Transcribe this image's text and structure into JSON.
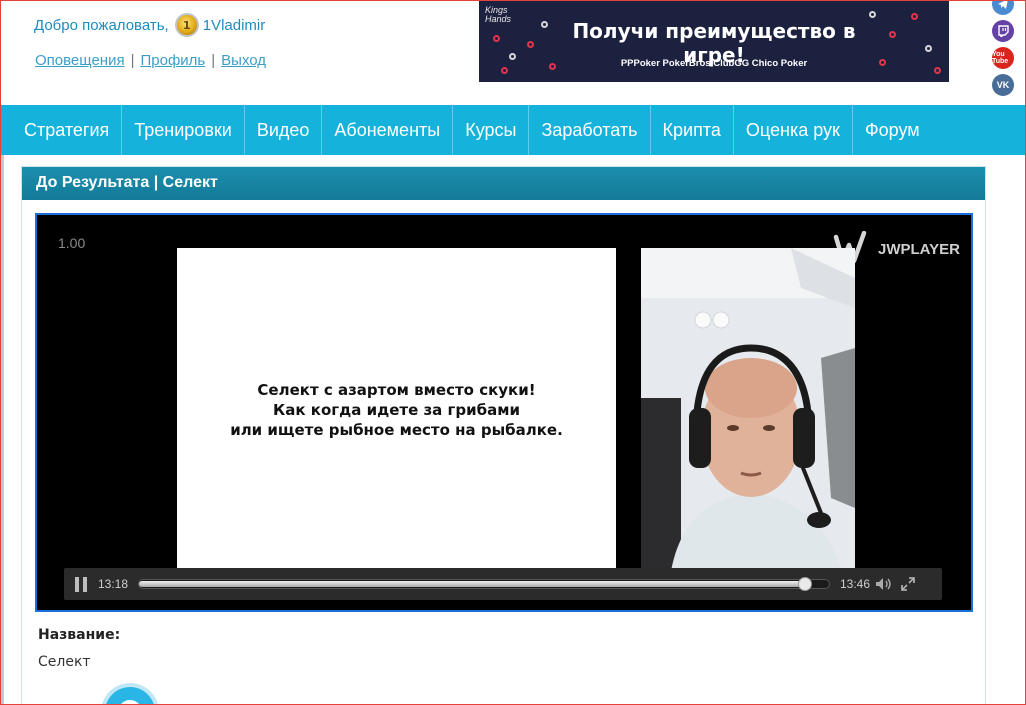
{
  "header": {
    "welcome_text": "Добро пожаловать,",
    "coin_symbol": "1",
    "username": "1Vladimir",
    "links": [
      "Оповещения",
      "Профиль",
      "Выход"
    ],
    "separator": "|"
  },
  "banner": {
    "brand_line1": "Kings",
    "brand_line2": "Hands",
    "title": "Получи преимущество в игре!",
    "subtitle": "PPPoker PokerBros ClubGG Chico Poker"
  },
  "social": {
    "icons": [
      "telegram-icon",
      "twitch-icon",
      "youtube-icon",
      "vk-icon"
    ],
    "youtube_label": "You Tube",
    "vk_label": "VK"
  },
  "nav": {
    "items": [
      "Стратегия",
      "Тренировки",
      "Видео",
      "Абонементы",
      "Курсы",
      "Заработать",
      "Крипта",
      "Оценка рук",
      "Форум"
    ]
  },
  "panel": {
    "title": "До Результата | Селект"
  },
  "player": {
    "speed": "1.00",
    "logo": "JWPLAYER",
    "slide_lines": [
      "Селект с азартом вместо скуки!",
      "Как когда идете за грибами",
      "или ищете рыбное место на рыбалке."
    ],
    "time_current": "13:18",
    "time_total": "13:46",
    "progress": 0.965
  },
  "details": {
    "label": "Название:",
    "value": "Селект"
  },
  "colors": {
    "nav_bg": "#15b3dc",
    "panel_head": "#1b8fae",
    "link": "#3c9ec6",
    "player_border": "#1c6fd9"
  }
}
